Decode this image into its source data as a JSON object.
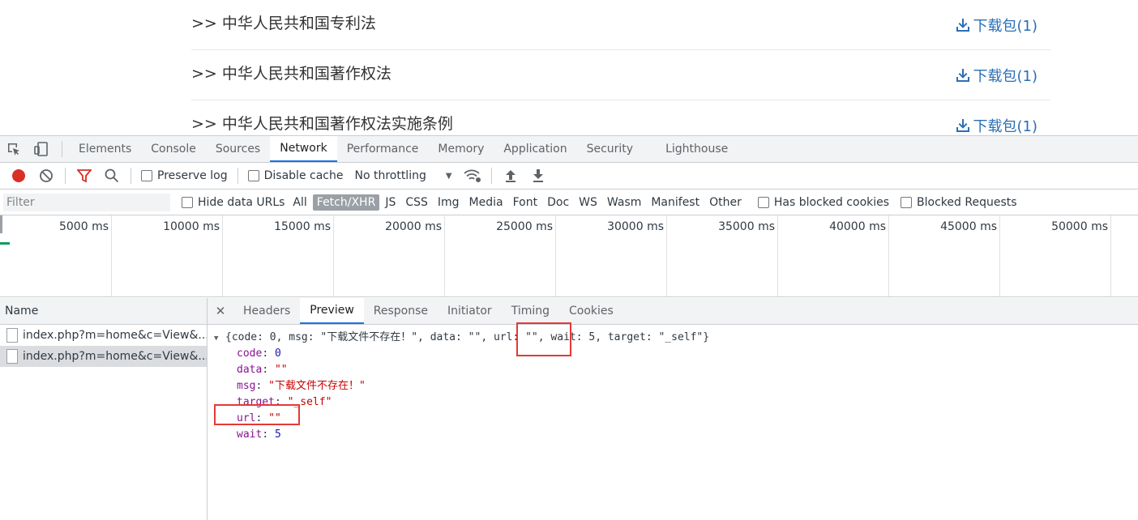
{
  "page": {
    "laws": [
      {
        "title": ">> 中华人民共和国专利法",
        "download": "下载包(1)"
      },
      {
        "title": ">> 中华人民共和国著作权法",
        "download": "下载包(1)"
      },
      {
        "title": ">> 中华人民共和国著作权法实施条例",
        "download": "下载包(1)"
      }
    ]
  },
  "devtools": {
    "tabs": [
      "Elements",
      "Console",
      "Sources",
      "Network",
      "Performance",
      "Memory",
      "Application",
      "Security",
      "Lighthouse"
    ],
    "active_tab": "Network",
    "toolbar": {
      "preserve_log": "Preserve log",
      "disable_cache": "Disable cache",
      "throttling": "No throttling"
    },
    "filter": {
      "placeholder": "Filter",
      "hide_data_urls": "Hide data URLs",
      "types": [
        "All",
        "Fetch/XHR",
        "JS",
        "CSS",
        "Img",
        "Media",
        "Font",
        "Doc",
        "WS",
        "Wasm",
        "Manifest",
        "Other"
      ],
      "active_type": "Fetch/XHR",
      "has_blocked_cookies": "Has blocked cookies",
      "blocked_requests": "Blocked Requests"
    },
    "timeline_labels": [
      "5000 ms",
      "10000 ms",
      "15000 ms",
      "20000 ms",
      "25000 ms",
      "30000 ms",
      "35000 ms",
      "40000 ms",
      "45000 ms",
      "50000 ms"
    ],
    "requests": {
      "header": "Name",
      "rows": [
        "index.php?m=home&c=View&...",
        "index.php?m=home&c=View&..."
      ],
      "selected_index": 1
    },
    "detail_tabs": [
      "Headers",
      "Preview",
      "Response",
      "Initiator",
      "Timing",
      "Cookies"
    ],
    "active_detail_tab": "Preview",
    "preview": {
      "summary": "{code: 0, msg: \"下载文件不存在！\", data: \"\", url: \"\", wait: 5, target: \"_self\"}",
      "fields": [
        {
          "key": "code",
          "value": "0",
          "kind": "num"
        },
        {
          "key": "data",
          "value": "\"\"",
          "kind": "str"
        },
        {
          "key": "msg",
          "value": "\"下载文件不存在！\"",
          "kind": "str"
        },
        {
          "key": "target",
          "value": "\"_self\"",
          "kind": "str"
        },
        {
          "key": "url",
          "value": "\"\"",
          "kind": "str"
        },
        {
          "key": "wait",
          "value": "5",
          "kind": "num"
        }
      ]
    },
    "colors": {
      "accent": "#1a73e8",
      "record": "#d93025",
      "highlight": "#e53935"
    }
  }
}
